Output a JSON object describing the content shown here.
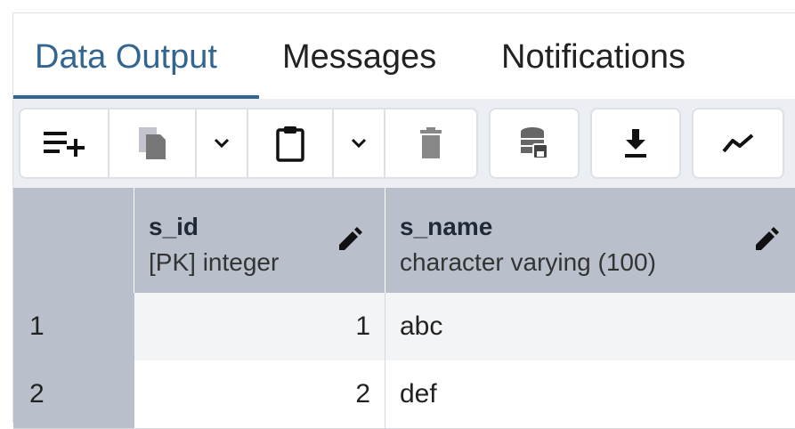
{
  "tabs": [
    {
      "label": "Data Output",
      "active": true
    },
    {
      "label": "Messages",
      "active": false
    },
    {
      "label": "Notifications",
      "active": false
    }
  ],
  "toolbar": {
    "icons": [
      "add-row-icon",
      "copy-icon",
      "chevron-down-icon",
      "paste-icon",
      "chevron-down-icon",
      "delete-icon",
      "save-data-icon",
      "download-icon",
      "graph-icon"
    ]
  },
  "grid": {
    "columns": [
      {
        "name": "s_id",
        "type": "[PK] integer"
      },
      {
        "name": "s_name",
        "type": "character varying (100)"
      }
    ],
    "rows": [
      {
        "num": "1",
        "s_id": "1",
        "s_name": "abc"
      },
      {
        "num": "2",
        "s_id": "2",
        "s_name": "def"
      }
    ]
  },
  "colors": {
    "accent": "#326690",
    "header_bg": "#b9c0cc",
    "toolbar_bg": "#ebeef3",
    "row_alt_bg": "#f3f4f6"
  }
}
